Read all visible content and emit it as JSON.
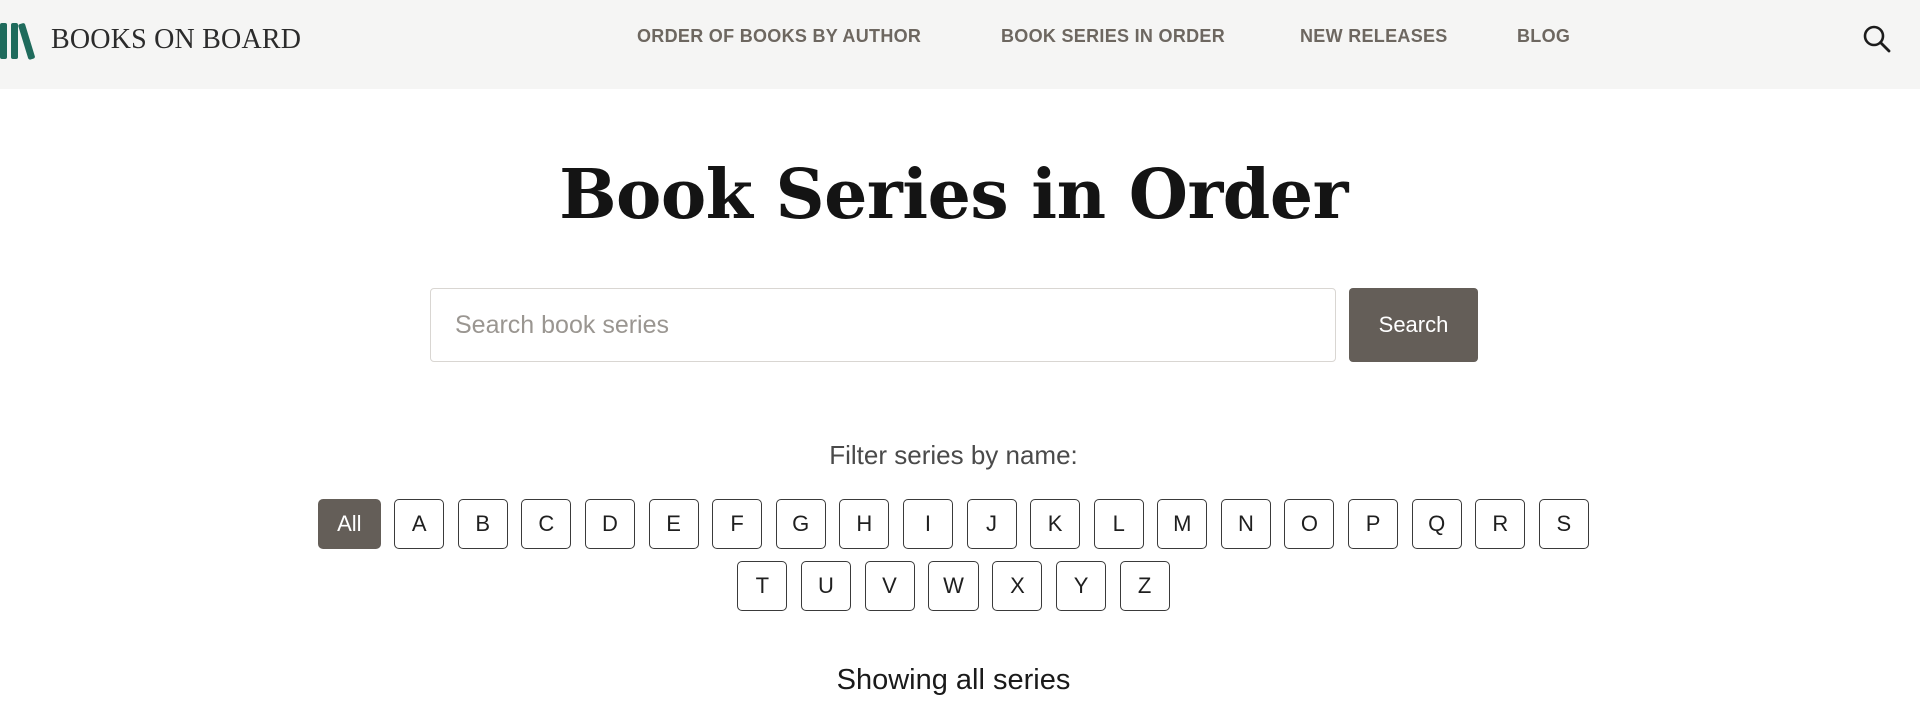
{
  "header": {
    "brand": "BOOKS ON BOARD",
    "nav": [
      {
        "label": "ORDER OF BOOKS BY AUTHOR"
      },
      {
        "label": "BOOK SERIES IN ORDER"
      },
      {
        "label": "NEW RELEASES"
      },
      {
        "label": "BLOG"
      }
    ],
    "search_icon": "search-icon",
    "logo_icon": "books-icon",
    "logo_color": "#1f6b5c"
  },
  "main": {
    "title": "Book Series in Order",
    "search": {
      "placeholder": "Search book series",
      "value": "",
      "button_label": "Search"
    },
    "filter": {
      "label": "Filter series by name:",
      "selected": "All",
      "options_row1": [
        "All",
        "A",
        "B",
        "C",
        "D",
        "E",
        "F",
        "G",
        "H",
        "I",
        "J",
        "K",
        "L",
        "M",
        "N",
        "O",
        "P",
        "Q",
        "R",
        "S"
      ],
      "options_row2": [
        "T",
        "U",
        "V",
        "W",
        "X",
        "Y",
        "Z"
      ]
    },
    "status": "Showing all series"
  },
  "colors": {
    "accent": "#645e58",
    "header_bg": "#f5f5f4",
    "nav_text": "#6d6760"
  }
}
